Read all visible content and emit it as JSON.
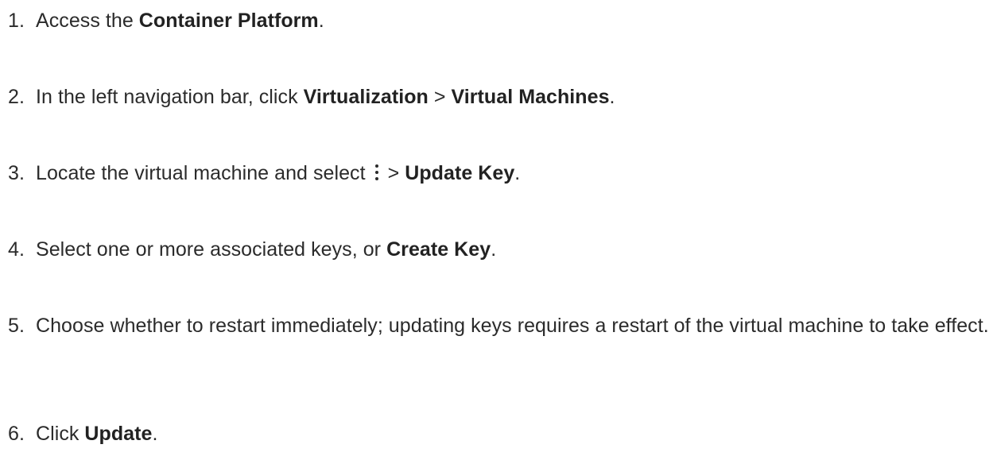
{
  "steps": [
    {
      "number": "1.",
      "before": "Access the ",
      "bold": "Container Platform",
      "after": "."
    },
    {
      "number": "2.",
      "before": "In the left navigation bar, click ",
      "bold1": "Virtualization",
      "mid": " > ",
      "bold2": "Virtual Machines",
      "after": "."
    },
    {
      "number": "3.",
      "before": "Locate the virtual machine and select ",
      "icon": "more-vertical-icon",
      "mid": " > ",
      "bold": "Update Key",
      "after": "."
    },
    {
      "number": "4.",
      "before": "Select one or more associated keys, or ",
      "bold": "Create Key",
      "after": "."
    },
    {
      "number": "5.",
      "text": "Choose whether to restart immediately; updating keys requires a restart of the virtual machine to take effect."
    },
    {
      "number": "6.",
      "before": "Click ",
      "bold": "Update",
      "after": "."
    }
  ]
}
